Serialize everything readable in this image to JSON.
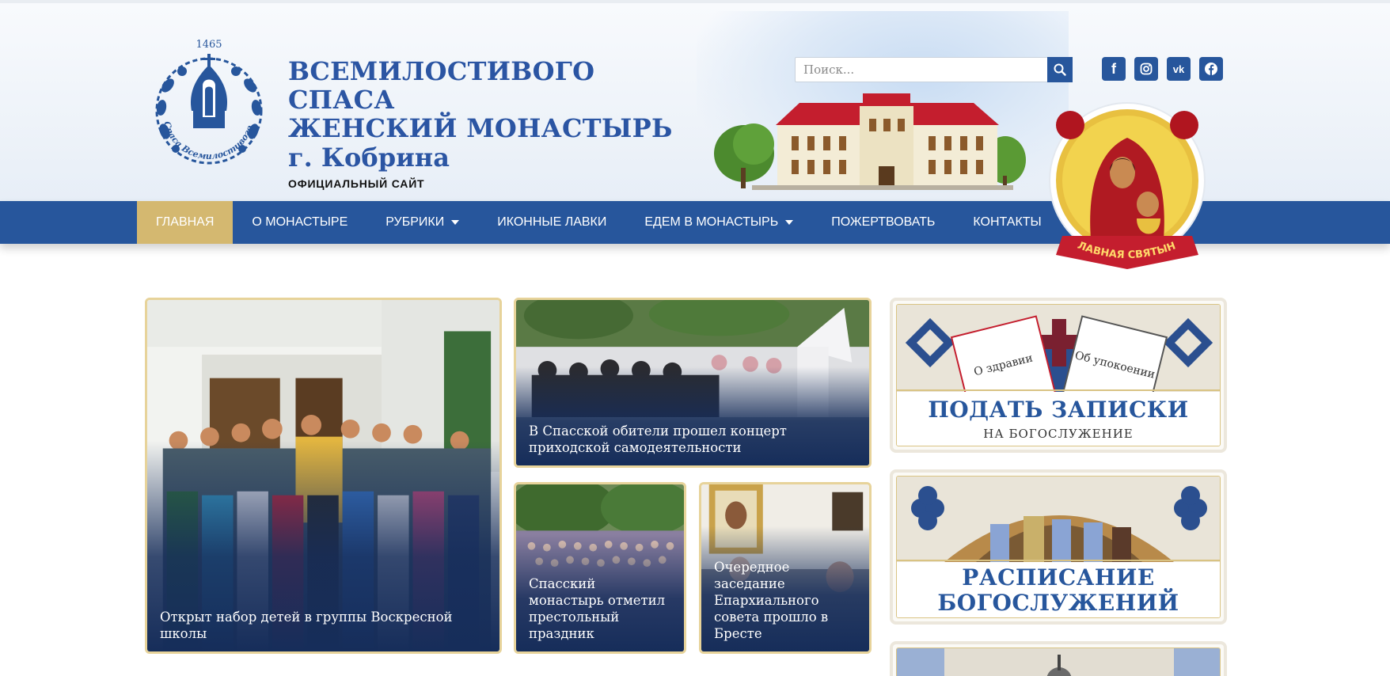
{
  "logo": {
    "year": "1465",
    "text": "обитель Спаса Всемилостивого г. Кобрин"
  },
  "site": {
    "title_line1": "ВСЕМИЛОСТИВОГО СПАСА",
    "title_line2": "ЖЕНСКИЙ МОНАСТЫРЬ",
    "title_line3": "г. Кобрина",
    "subtitle": "ОФИЦИАЛЬНЫЙ САЙТ"
  },
  "search": {
    "placeholder": "Поиск..."
  },
  "social": {
    "facebook": "f",
    "vk": "vk"
  },
  "icon_badge": {
    "text": "ГЛАВНАЯ СВЯТЫНЯ"
  },
  "nav": {
    "items": [
      {
        "label": "ГЛАВНАЯ"
      },
      {
        "label": "О МОНАСТЫРЕ"
      },
      {
        "label": "РУБРИКИ"
      },
      {
        "label": "ИКОННЫЕ ЛАВКИ"
      },
      {
        "label": "ЕДЕМ В МОНАСТЫРЬ"
      },
      {
        "label": "ПОЖЕРТВОВАТЬ"
      },
      {
        "label": "КОНТАКТЫ"
      }
    ]
  },
  "news": [
    {
      "caption": "Открыт набор детей в группы Воскресной школы"
    },
    {
      "caption": "В Спасской обители прошел концерт приходской самодеятельности"
    },
    {
      "caption": "Спасский монастырь отметил престольный праздник"
    },
    {
      "caption": "Очередное заседание Епархиального совета прошло в Бресте"
    }
  ],
  "banners": [
    {
      "title": "ПОДАТЬ ЗАПИСКИ",
      "subtitle": "НА БОГОСЛУЖЕНИЕ",
      "note1": "О здравии",
      "note2": "Об упокоении"
    },
    {
      "title_line1": "РАСПИСАНИЕ",
      "title_line2": "БОГОСЛУЖЕНИЙ"
    }
  ],
  "colors": {
    "brand_blue": "#27569c",
    "gold": "#d4b870",
    "overlay_navy": "#162d5a"
  }
}
